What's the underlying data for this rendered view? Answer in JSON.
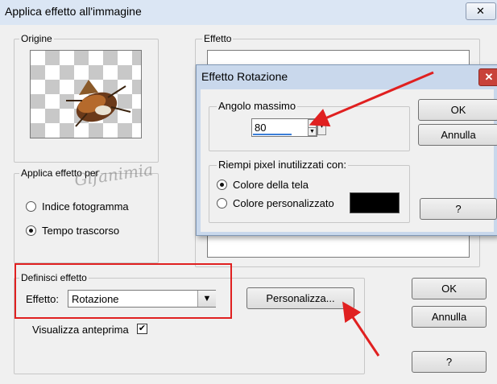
{
  "main": {
    "title": "Applica effetto all'immagine",
    "close_symbol": "✕",
    "origin_label": "Origine",
    "effect_label": "Effetto",
    "apply_group": {
      "label": "Applica effetto per",
      "options": [
        "Indice fotogramma",
        "Tempo trascorso"
      ],
      "selected_index": 1
    },
    "define_group": {
      "label": "Definisci effetto",
      "effect_field_label": "Effetto:",
      "effect_value": "Rotazione",
      "customize_button": "Personalizza..."
    },
    "preview_checkbox_label": "Visualizza anteprima",
    "preview_checked": true,
    "ok_button": "OK",
    "cancel_button": "Annulla",
    "help_button": "?"
  },
  "sub": {
    "title": "Effetto Rotazione",
    "close_symbol": "✕",
    "max_angle_label": "Angolo massimo",
    "max_angle_value": "80",
    "fill_group_label": "Riempi pixel inutilizzati con:",
    "fill_options": [
      "Colore della tela",
      "Colore personalizzato"
    ],
    "fill_selected_index": 0,
    "custom_color": "#000000",
    "ok_button": "OK",
    "cancel_button": "Annulla",
    "help_button": "?"
  },
  "watermark_text": "Gifanimia",
  "colors": {
    "annotation_red": "#e02020",
    "title_bg": "#dbe6f4",
    "dialog_bg": "#f0f0f0"
  }
}
